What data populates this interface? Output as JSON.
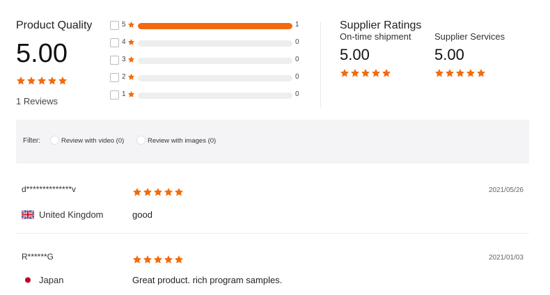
{
  "product_quality": {
    "title": "Product Quality",
    "score": "5.00",
    "stars": 5,
    "reviews_label": "1 Reviews"
  },
  "histogram": [
    {
      "stars": "5",
      "count": "1",
      "fraction": 1.0
    },
    {
      "stars": "4",
      "count": "0",
      "fraction": 0
    },
    {
      "stars": "3",
      "count": "0",
      "fraction": 0
    },
    {
      "stars": "2",
      "count": "0",
      "fraction": 0
    },
    {
      "stars": "1",
      "count": "0",
      "fraction": 0
    }
  ],
  "supplier_ratings": {
    "title": "Supplier Ratings",
    "shipment": {
      "label": "On-time shipment",
      "score": "5.00",
      "stars": 5
    },
    "services": {
      "label": "Supplier Services",
      "score": "5.00",
      "stars": 5
    }
  },
  "filter": {
    "label": "Filter:",
    "options": [
      "Review with video (0)",
      "Review with images (0)"
    ]
  },
  "reviews": [
    {
      "user": "d**************v",
      "date": "2021/05/26",
      "country": "United Kingdom",
      "flag": "uk-flag-icon",
      "text": "good",
      "stars": 5
    },
    {
      "user": "R******G",
      "date": "2021/01/03",
      "country": "Japan",
      "flag": "japan-flag-icon",
      "text": "Great product. rich program samples.",
      "stars": 5
    }
  ],
  "colors": {
    "accent": "#f26b0f",
    "bar_bg": "#eeeef0",
    "filter_bg": "#f4f4f6"
  }
}
